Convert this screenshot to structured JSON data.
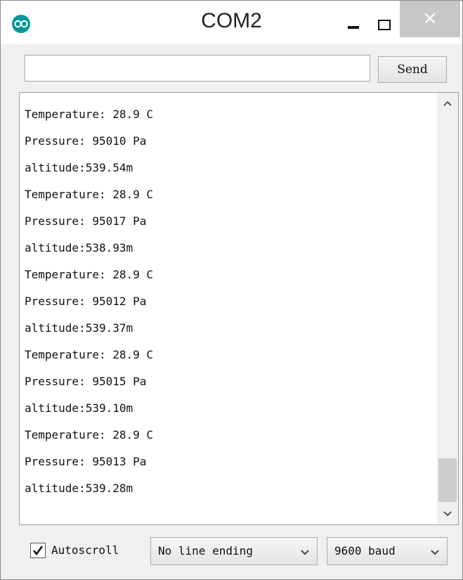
{
  "window": {
    "title": "COM2",
    "close_glyph": "×"
  },
  "send": {
    "input_value": "",
    "button_label": "Send"
  },
  "output": {
    "lines": [
      "Temperature: 28.9 C",
      "Pressure: 95010 Pa",
      "altitude:539.54m",
      "Temperature: 28.9 C",
      "Pressure: 95017 Pa",
      "altitude:538.93m",
      "Temperature: 28.9 C",
      "Pressure: 95012 Pa",
      "altitude:539.37m",
      "Temperature: 28.9 C",
      "Pressure: 95015 Pa",
      "altitude:539.10m",
      "Temperature: 28.9 C",
      "Pressure: 95013 Pa",
      "altitude:539.28m"
    ]
  },
  "footer": {
    "autoscroll_label": "Autoscroll",
    "autoscroll_checked": true,
    "line_ending_selected": "No line ending",
    "baud_selected": "9600 baud"
  },
  "colors": {
    "app_icon": "#00979c",
    "close_button": "#c7c7c7"
  }
}
